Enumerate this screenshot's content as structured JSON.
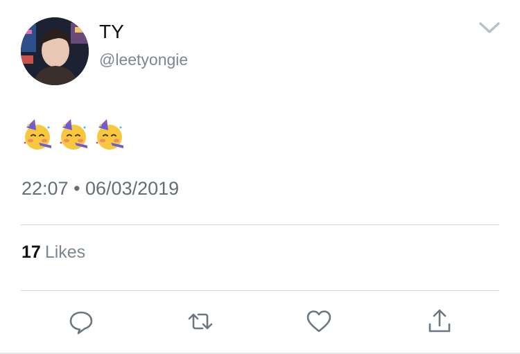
{
  "tweet": {
    "author": {
      "display_name": "TY",
      "handle": "@leetyongie"
    },
    "body_emojis": [
      "🥳",
      "🥳",
      "🥳"
    ],
    "timestamp": "22:07 • 06/03/2019"
  },
  "stats": {
    "likes_count": "17",
    "likes_label": "Likes"
  },
  "actions": [
    "reply-icon",
    "retweet-icon",
    "like-icon",
    "share-icon"
  ],
  "colors": {
    "text_primary": "#111111",
    "text_secondary": "#7a8791",
    "divider": "#d3d8dc",
    "icon": "#6b7680"
  }
}
